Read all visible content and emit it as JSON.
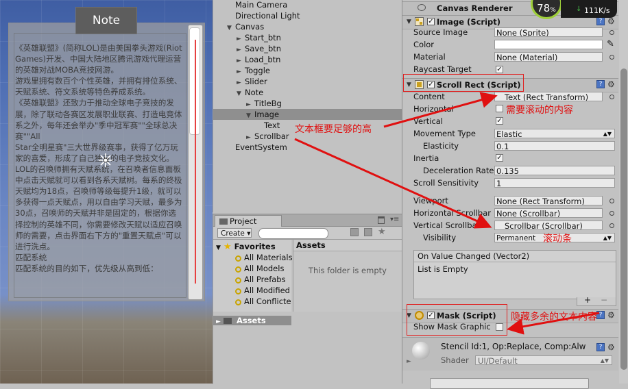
{
  "scene": {
    "note_title": "Note",
    "note_text": "《英雄联盟》(简称LOL)是由美国拳头游戏(Riot\nGames)开发、中国大陆地区腾讯游戏代理运营的英雄对战MOBA竞技网游。\n游戏里拥有数百个个性英雄，并拥有排位系统、天赋系统、符文系统等特色养成系统。\n《英雄联盟》还致力于推动全球电子竞技的发展，除了联动各赛区发展职业联赛、打造电竞体系之外，每年还会举办\"季中冠军赛\"\"全球总决赛\"\"All\nStar全明星赛\"三大世界级赛事，获得了亿万玩家的喜爱，形成了自己独有的电子竞技文化。\nLOL的召唤师拥有天赋系统，在召唤者信息面板中点击天赋就可以看到各系天赋树。每系的终极天赋均为18点，召唤师等级每提升1级，就可以多获得一点天赋点，用以自由学习天赋，最多为30点，召唤师的天赋并非是固定的，根据你选择控制的英雄不同，你需要修改天赋以适应召唤师的需要，点击界面右下方的\"重置天赋点\"可以进行洗点。\n匹配系统\n匹配系统的目的如下，优先级从高到低：\n\n\n保护新手不被有经验的玩家虐；让高手局中没有新手。"
  },
  "hierarchy": {
    "items": [
      {
        "label": "Main Camera",
        "indent": 0,
        "arrow": ""
      },
      {
        "label": "Directional Light",
        "indent": 0,
        "arrow": ""
      },
      {
        "label": "Canvas",
        "indent": 0,
        "arrow": "▼"
      },
      {
        "label": "Start_btn",
        "indent": 1,
        "arrow": "►"
      },
      {
        "label": "Save_btn",
        "indent": 1,
        "arrow": "►"
      },
      {
        "label": "Load_btn",
        "indent": 1,
        "arrow": "►"
      },
      {
        "label": "Toggle",
        "indent": 1,
        "arrow": "►"
      },
      {
        "label": "Slider",
        "indent": 1,
        "arrow": "►"
      },
      {
        "label": "Note",
        "indent": 1,
        "arrow": "▼"
      },
      {
        "label": "TitleBg",
        "indent": 2,
        "arrow": "►"
      },
      {
        "label": "Image",
        "indent": 2,
        "arrow": "▼",
        "selected": true
      },
      {
        "label": "Text",
        "indent": 3,
        "arrow": ""
      },
      {
        "label": "Scrollbar",
        "indent": 2,
        "arrow": "►"
      },
      {
        "label": "EventSystem",
        "indent": 0,
        "arrow": ""
      }
    ]
  },
  "project": {
    "tab_label": "Project",
    "create_label": "Create",
    "favorites_label": "Favorites",
    "favorites": [
      "All Materials",
      "All Models",
      "All Prefabs",
      "All Modified",
      "All Conflicte"
    ],
    "assets_header": "Assets",
    "empty_text": "This folder is empty",
    "assets_row": "Assets"
  },
  "inspector": {
    "canvas_renderer": "Canvas Renderer",
    "image": {
      "title": "Image (Script)",
      "source_image_label": "Source Image",
      "source_image_value": "None (Sprite)",
      "color_label": "Color",
      "material_label": "Material",
      "material_value": "None (Material)",
      "raycast_label": "Raycast Target"
    },
    "scroll_rect": {
      "title": "Scroll Rect (Script)",
      "content_label": "Content",
      "content_value": "Text (Rect Transform)",
      "horizontal_label": "Horizontal",
      "vertical_label": "Vertical",
      "movement_label": "Movement Type",
      "movement_value": "Elastic",
      "elasticity_label": "Elasticity",
      "elasticity_value": "0.1",
      "inertia_label": "Inertia",
      "decel_label": "Deceleration Rate",
      "decel_value": "0.135",
      "sensitivity_label": "Scroll Sensitivity",
      "sensitivity_value": "1",
      "viewport_label": "Viewport",
      "viewport_value": "None (Rect Transform)",
      "hscroll_label": "Horizontal Scrollbar",
      "hscroll_value": "None (Scrollbar)",
      "vscroll_label": "Vertical Scrollbar",
      "vscroll_value": "Scrollbar (Scrollbar)",
      "visibility_label": "Visibility",
      "visibility_value": "Permanent",
      "event_label": "On Value Changed (Vector2)",
      "event_empty": "List is Empty"
    },
    "mask": {
      "title": "Mask (Script)",
      "show_graphic_label": "Show Mask Graphic"
    },
    "stencil_text": "Stencil Id:1, Op:Replace, Comp:Alw",
    "shader_label": "Shader",
    "shader_value": "UI/Default"
  },
  "annotations": {
    "content_note": "需要滚动的内容",
    "text_note": "文本框要足够的高",
    "scrollbar_note": "滚动条",
    "mask_note": "隐藏多余的文本内容"
  },
  "widget": {
    "percent": "78",
    "percent_unit": "%",
    "speed": "111K/s"
  },
  "colors": {
    "annotation": "#e01010",
    "selection": "#8f8f8f",
    "scroll_line": "#e64040"
  }
}
